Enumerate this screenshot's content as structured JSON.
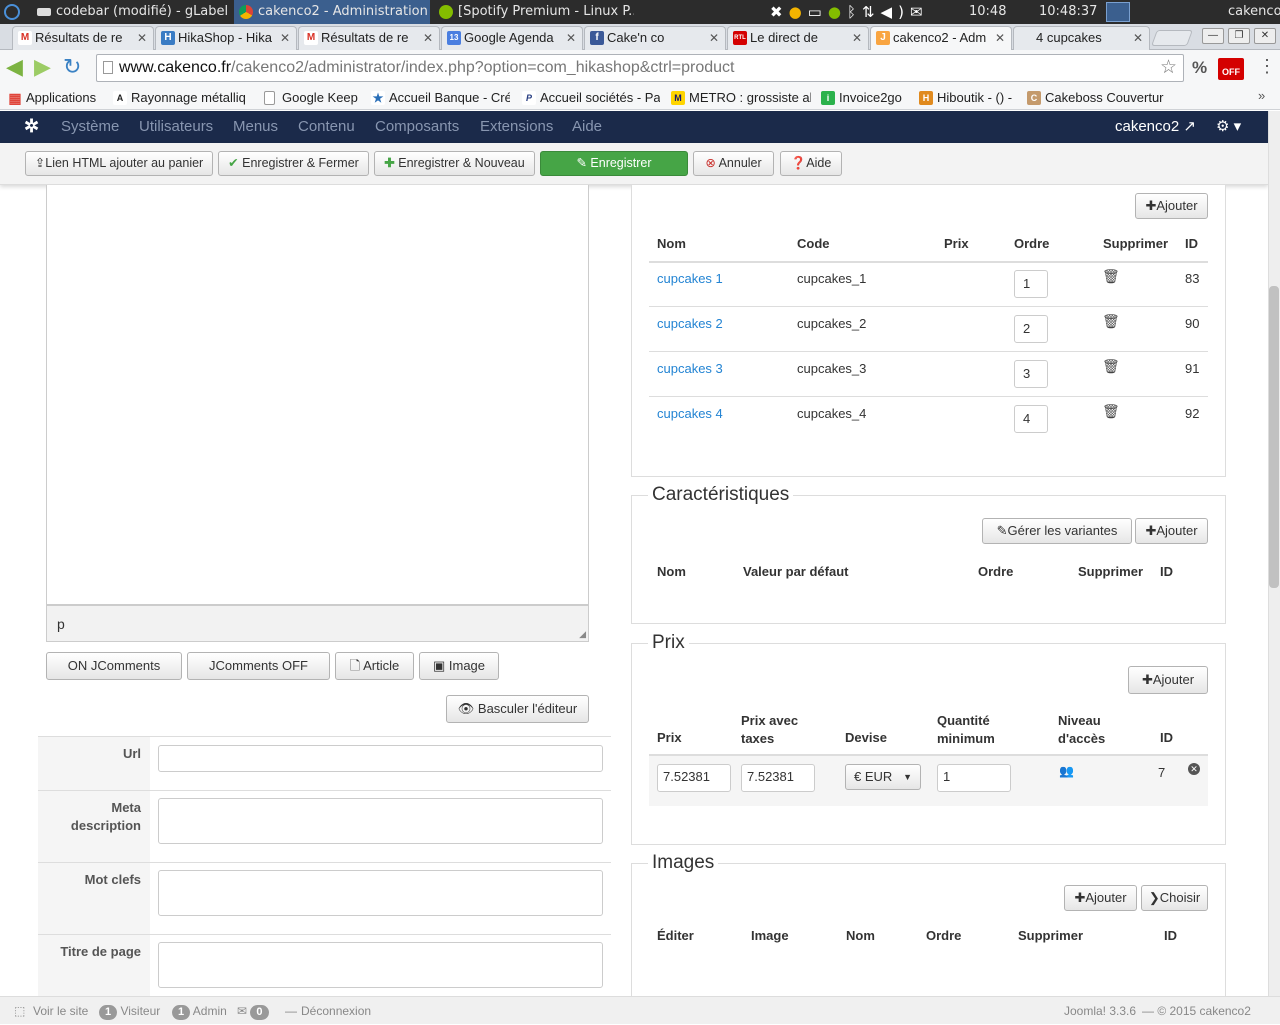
{
  "os_taskbar": {
    "tasks": [
      {
        "label": "codebar (modifié) - gLabels",
        "active": false
      },
      {
        "label": "cakenco2 - Administration ...",
        "active": true
      },
      {
        "label": "[Spotify Premium - Linux P...",
        "active": false
      }
    ],
    "clock_short": "10:48",
    "clock_long": "10:48:37",
    "user": "cakenco"
  },
  "browser_tabs": [
    {
      "label": "Résultats de re",
      "icon": "gmail-icon",
      "color": "#d93025",
      "glyph": "M"
    },
    {
      "label": "HikaShop - Hika",
      "icon": "hikashop-icon",
      "color": "#3a7cc4",
      "glyph": "H"
    },
    {
      "label": "Résultats de re",
      "icon": "gmail-icon",
      "color": "#d93025",
      "glyph": "M"
    },
    {
      "label": "Google Agenda",
      "icon": "calendar-icon",
      "color": "#4a7ee0",
      "glyph": "13"
    },
    {
      "label": "Cake'n co",
      "icon": "facebook-icon",
      "color": "#3b5998",
      "glyph": "f"
    },
    {
      "label": "Le direct de",
      "icon": "rtl-icon",
      "color": "#d40000",
      "glyph": "RTL"
    },
    {
      "label": "cakenco2 - Adm",
      "icon": "joomla-icon",
      "color": "#f9a541",
      "glyph": "J",
      "active": true
    },
    {
      "label": "4 cupcakes",
      "icon": "",
      "color": "",
      "glyph": ""
    }
  ],
  "address": {
    "host": "www.cakenco.fr",
    "path": "/cakenco2/administrator/index.php?option=com_hikashop&ctrl=product"
  },
  "bookmarks": [
    {
      "label": "Applications",
      "icon": "apps-grid-icon",
      "color": "#e0453a",
      "glyph": "▦"
    },
    {
      "label": "Rayonnage métalliq",
      "icon": "rayonnage-icon",
      "color": "#222",
      "glyph": "A"
    },
    {
      "label": "Google Keep",
      "icon": "page-icon",
      "color": "#bbb",
      "glyph": ""
    },
    {
      "label": "Accueil Banque - Cré",
      "icon": "star-icon",
      "color": "#2a6fb8",
      "glyph": "★"
    },
    {
      "label": "Accueil sociétés - Pa",
      "icon": "paypal-icon",
      "color": "#253b80",
      "glyph": "P"
    },
    {
      "label": "METRO : grossiste al",
      "icon": "metro-icon",
      "color": "#1a1a6e",
      "glyph": "M"
    },
    {
      "label": "Invoice2go",
      "icon": "invoice-icon",
      "color": "#2bb24c",
      "glyph": "i"
    },
    {
      "label": "Hiboutik - () -",
      "icon": "hiboutik-icon",
      "color": "#e08a1e",
      "glyph": "H"
    },
    {
      "label": "Cakeboss Couvertur",
      "icon": "cake-icon",
      "color": "#c49a6c",
      "glyph": "C"
    }
  ],
  "joomla_menu": {
    "items": [
      "Système",
      "Utilisateurs",
      "Menus",
      "Contenu",
      "Composants",
      "Extensions",
      "Aide"
    ],
    "site_link": "cakenco2 ↗"
  },
  "toolbar": {
    "html_link": "Lien HTML ajouter au panier",
    "save_close": "Enregistrer & Fermer",
    "save_new": "Enregistrer & Nouveau",
    "save": "Enregistrer",
    "cancel": "Annuler",
    "help": "Aide"
  },
  "editor": {
    "path_label": "p",
    "buttons": {
      "jc_on": "ON JComments",
      "jc_off": "JComments OFF",
      "article": "Article",
      "image": "Image"
    },
    "toggle": "Basculer l'éditeur"
  },
  "meta_form": {
    "url_label": "Url",
    "meta_desc_label_1": "Meta",
    "meta_desc_label_2": "description",
    "keywords_label": "Mot clefs",
    "page_title_label": "Titre de page"
  },
  "variants": {
    "add_label": "Ajouter",
    "headers": {
      "name": "Nom",
      "code": "Code",
      "price": "Prix",
      "order": "Ordre",
      "delete": "Supprimer",
      "id": "ID"
    },
    "rows": [
      {
        "name": "cupcakes 1",
        "code": "cupcakes_1",
        "order": "1",
        "id": "83"
      },
      {
        "name": "cupcakes 2",
        "code": "cupcakes_2",
        "order": "2",
        "id": "90"
      },
      {
        "name": "cupcakes 3",
        "code": "cupcakes_3",
        "order": "3",
        "id": "91"
      },
      {
        "name": "cupcakes 4",
        "code": "cupcakes_4",
        "order": "4",
        "id": "92"
      }
    ]
  },
  "characteristics": {
    "title": "Caractéristiques",
    "manage_label": "Gérer les variantes",
    "add_label": "Ajouter",
    "headers": {
      "name": "Nom",
      "default": "Valeur par défaut",
      "order": "Ordre",
      "delete": "Supprimer",
      "id": "ID"
    }
  },
  "prices": {
    "title": "Prix",
    "add_label": "Ajouter",
    "headers": {
      "price": "Prix",
      "price_tax_1": "Prix avec",
      "price_tax_2": "taxes",
      "currency": "Devise",
      "qty_1": "Quantité",
      "qty_2": "minimum",
      "access_1": "Niveau",
      "access_2": "d'accès",
      "id": "ID"
    },
    "row": {
      "price": "7.52381",
      "price_tax": "7.52381",
      "currency": "€ EUR",
      "qty": "1",
      "id": "7"
    }
  },
  "images": {
    "title": "Images",
    "add_label": "Ajouter",
    "choose_label": "Choisir",
    "headers": {
      "edit": "Éditer",
      "image": "Image",
      "name": "Nom",
      "order": "Ordre",
      "delete": "Supprimer",
      "id": "ID"
    }
  },
  "statusbar": {
    "view_site": "Voir le site",
    "visitors_count": "1",
    "visitors_label": "Visiteur",
    "admin_count": "1",
    "admin_label": "Admin",
    "msg_count": "0",
    "logout": "Déconnexion",
    "version": "Joomla! 3.3.6",
    "copyright": "— © 2015 cakenco2"
  }
}
